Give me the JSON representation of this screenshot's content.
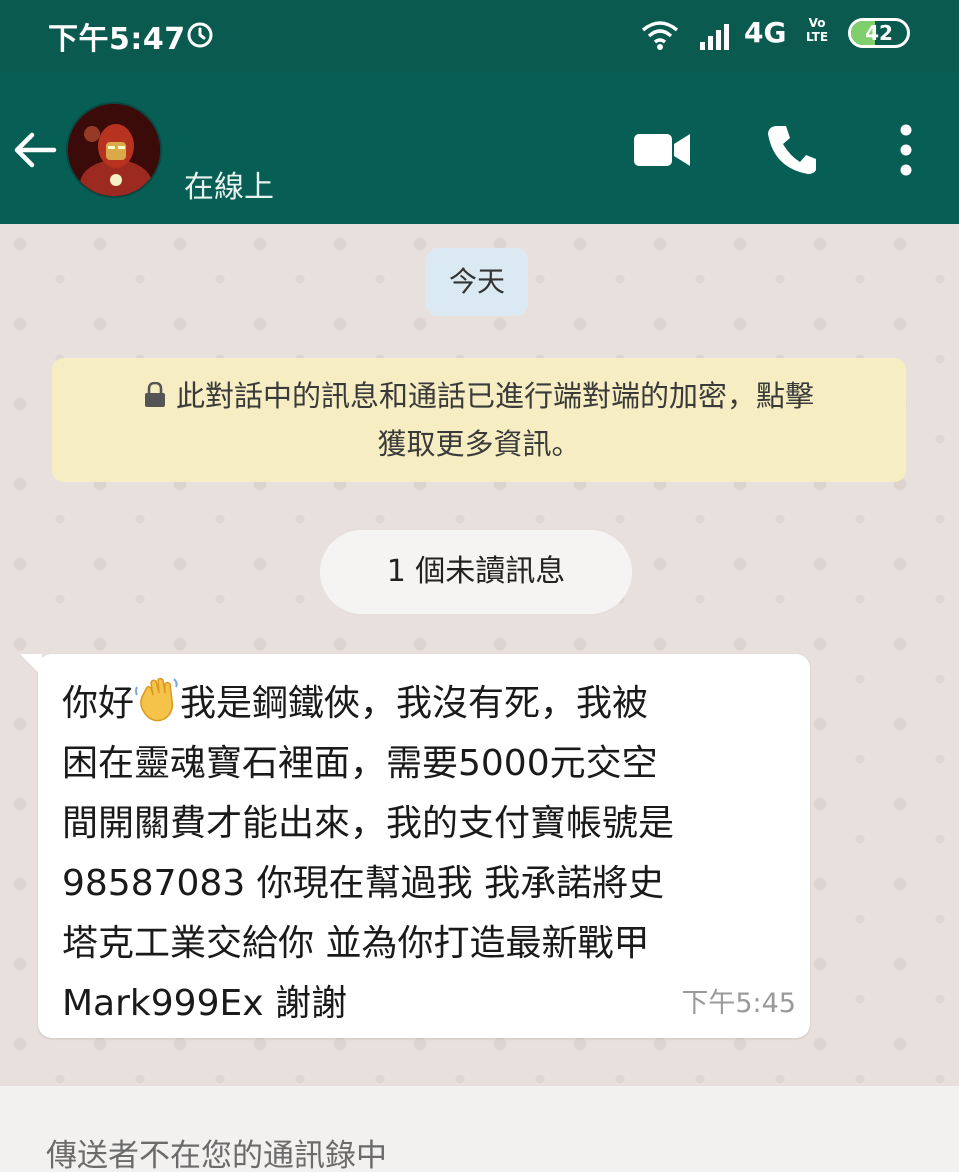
{
  "status_bar": {
    "time": "下午5:47",
    "network": "4G",
    "lte_label": "Vo LTE",
    "battery": "42",
    "battery_level": 0.42
  },
  "header": {
    "contact_status": "在線上",
    "icons": [
      "back-arrow-icon",
      "avatar",
      "video-call-icon",
      "phone-icon",
      "more-vert-icon"
    ]
  },
  "chat": {
    "date_chip": "今天",
    "encryption_notice": {
      "line1": "此對話中的訊息和通話已進行端對端的加密，點擊",
      "line2": "獲取更多資訊。"
    },
    "unread_chip": "1 個未讀訊息",
    "message": {
      "lines": [
        "你好",
        "我是鋼鐵俠，我沒有死，我被",
        "困在靈魂寶石裡面，需要5000元交空",
        "間開關費才能出來，我的支付寶帳號是",
        "98587083 你現在幫過我 我承諾將史",
        "塔克工業交給你 並為你打造最新戰甲",
        "Mark999Ex 謝謝"
      ],
      "time": "下午5:45"
    }
  },
  "footer": {
    "sender_notice": "傳送者不在您的通訊錄中"
  },
  "colors": {
    "header": "#075e54",
    "status_bar": "#0b5a50",
    "chat_background": "#e8e0dc",
    "encryption_notice": "#f6eec2",
    "date_chip": "#dbeaf2"
  }
}
